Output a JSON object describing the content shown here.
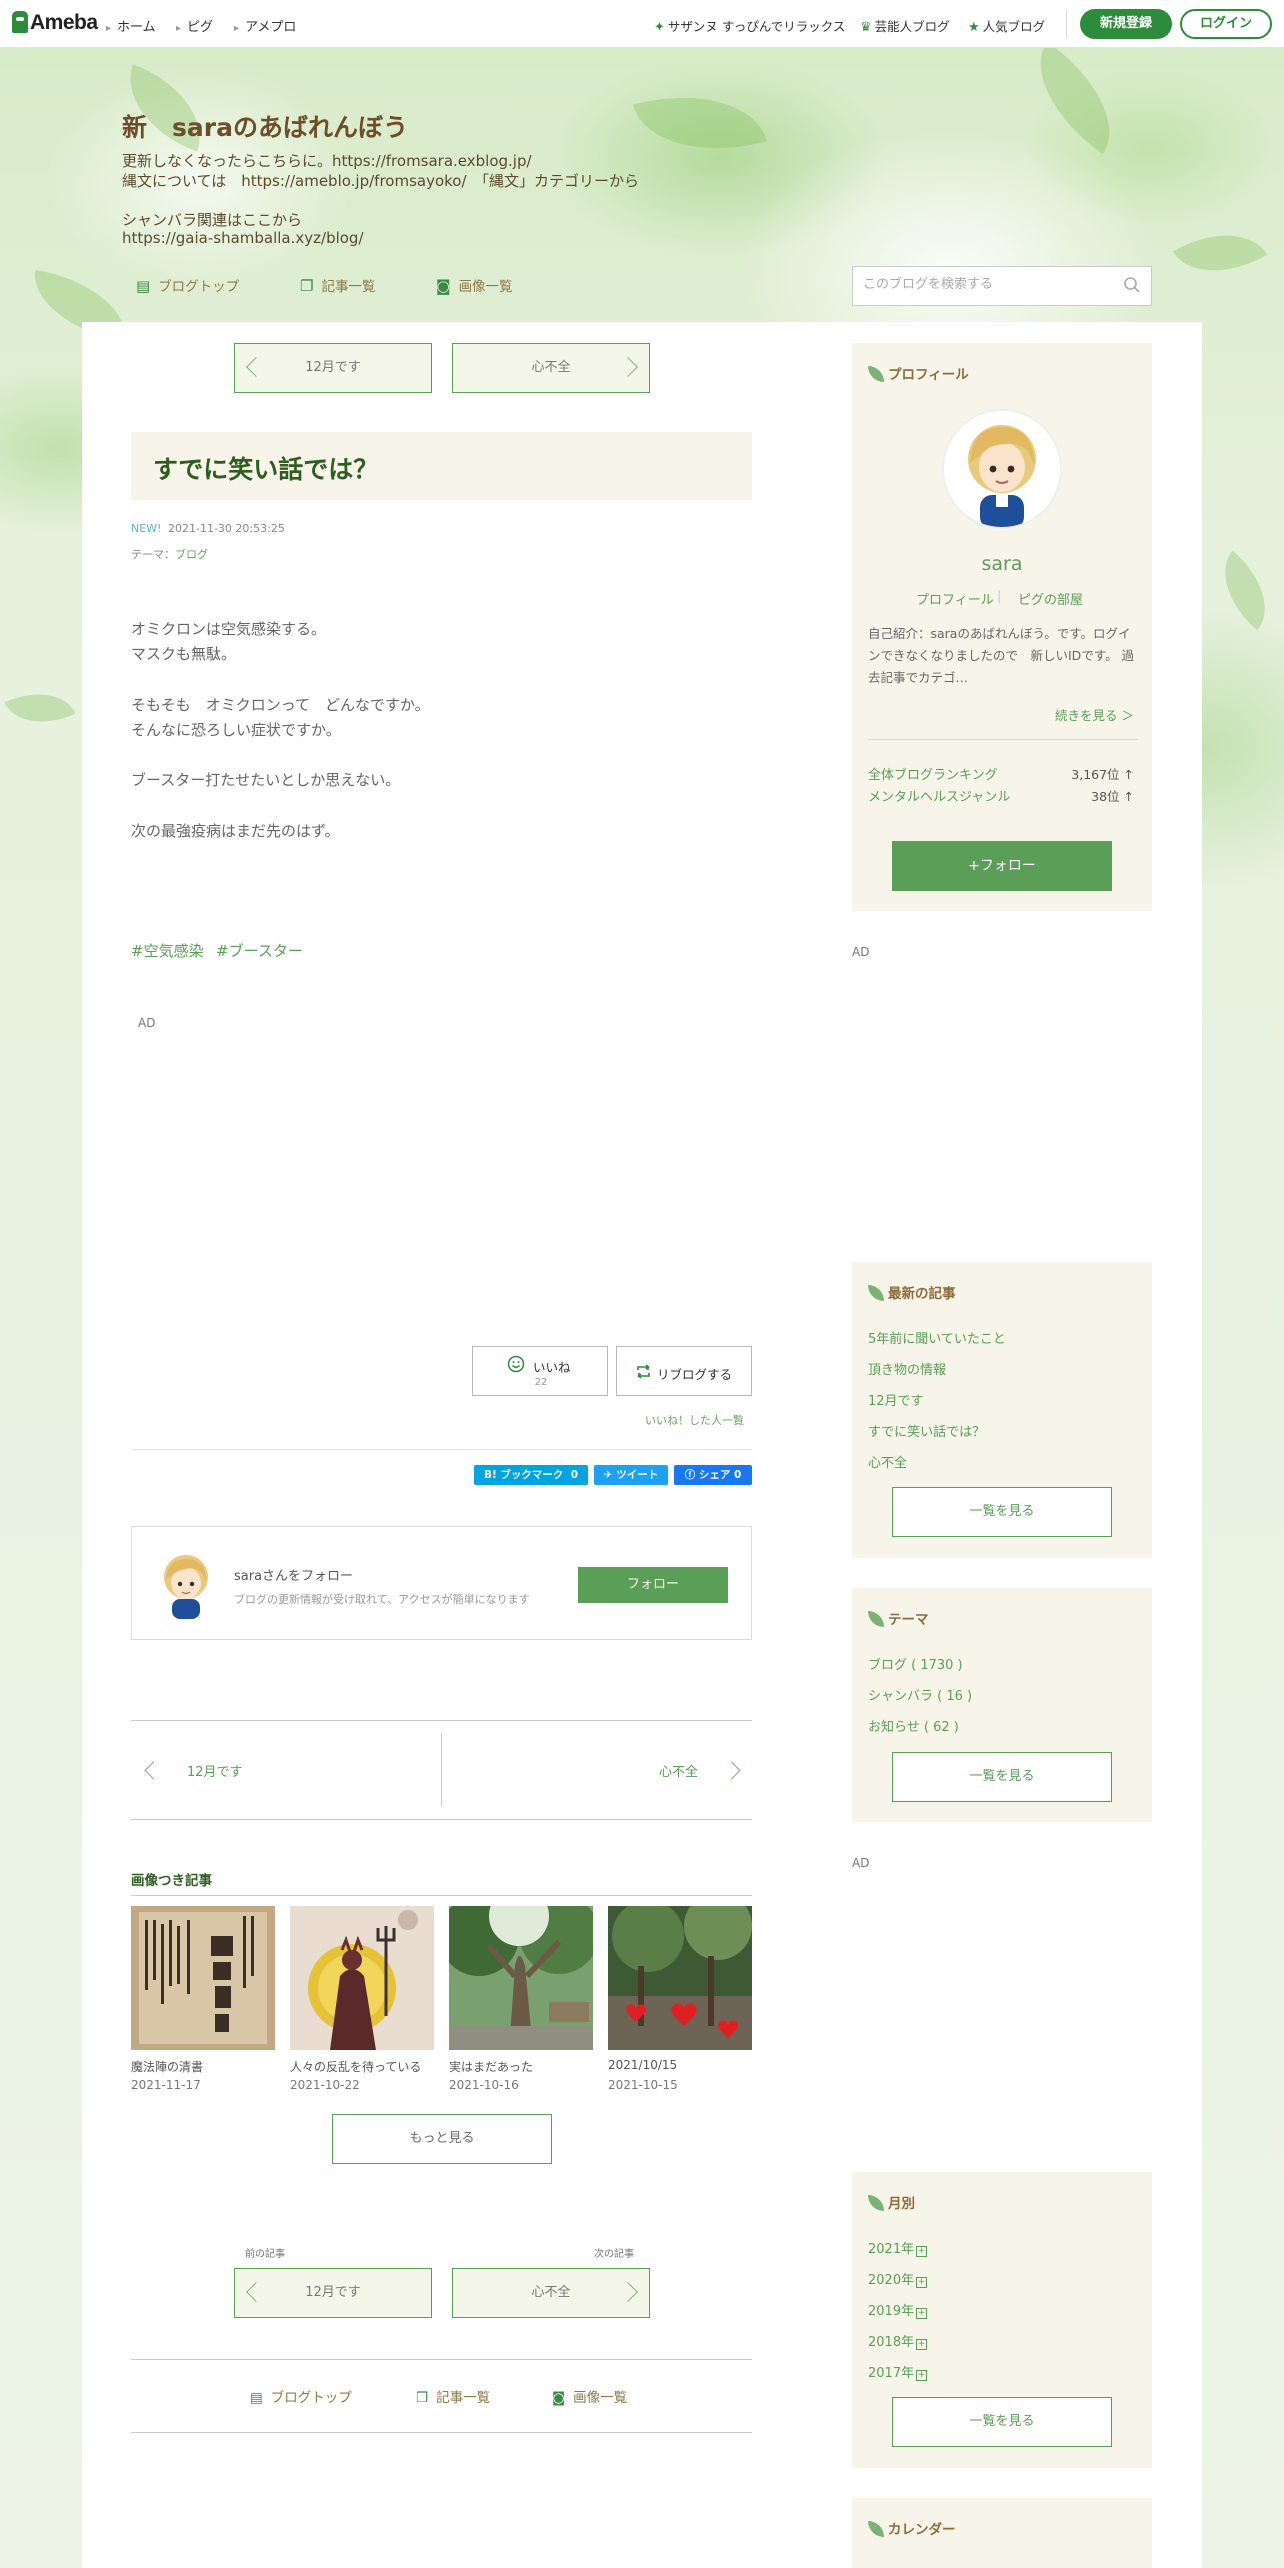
{
  "topnav": {
    "logo": "Ameba",
    "crumbs": [
      "ホーム",
      "ピグ",
      "アメプロ"
    ],
    "links": [
      "サザンヌ すっぴんでリラックス",
      "芸能人ブログ",
      "人気ブログ"
    ],
    "register": "新規登録",
    "login": "ログイン"
  },
  "header": {
    "title": "新　saraのあばれんぼう",
    "desc": [
      "更新しなくなったらこちらに。https://fromsara.exblog.jp/",
      "縄文については　https://ameblo.jp/fromsayoko/　「縄文」カテゴリーから",
      "シャンバラ関連はここから",
      "https://gaia-shamballa.xyz/blog/"
    ],
    "nav": [
      "ブログトップ",
      "記事一覧",
      "画像一覧"
    ],
    "search_placeholder": "このブログを検索する"
  },
  "pager_top": {
    "prev": "12月です",
    "next": "心不全"
  },
  "article": {
    "title": "すでに笑い話では？",
    "badge": "NEW!",
    "date": "2021-11-30 20:53:25",
    "theme_prefix": "テーマ：",
    "theme": "ブログ",
    "lines": [
      "オミクロンは空気感染する。",
      "マスクも無駄。",
      "そもそも　オミクロンって　どんなですか。",
      "そんなに恐ろしい症状ですか。",
      "ブースター打たせたいとしか思えない。",
      "次の最強疫病はまだ先のはず。"
    ],
    "hashtags": [
      "#空気感染",
      "#ブースター"
    ],
    "ad": "AD",
    "like_label": "いいね",
    "like_count": "22",
    "reblog_label": "リブログする",
    "like_list": "いいね！した人一覧",
    "share": {
      "hatena": "B! ブックマーク",
      "hatena_count": "0",
      "tweet": "ツイート",
      "fb": "シェア",
      "fb_count": "0"
    }
  },
  "follow_card": {
    "title": "saraさんをフォロー",
    "desc": "ブログの更新情報が受け取れて、アクセスが簡単になります",
    "button": "フォロー"
  },
  "pager_bottom": {
    "prev": "12月です",
    "next": "心不全"
  },
  "image_articles": {
    "title": "画像つき記事",
    "items": [
      {
        "title": "魔法陣の清書",
        "date": "2021-11-17"
      },
      {
        "title": "人々の反乱を待っている",
        "date": "2021-10-22"
      },
      {
        "title": "実はまだあった",
        "date": "2021-10-16"
      },
      {
        "title": "2021/10/15",
        "date": "2021-10-15"
      }
    ],
    "more": "もっと見る"
  },
  "pager_footer": {
    "prev_label": "前の記事",
    "next_label": "次の記事",
    "prev": "12月です",
    "next": "心不全"
  },
  "footer_nav": [
    "ブログトップ",
    "記事一覧",
    "画像一覧"
  ],
  "sidebar": {
    "profile": {
      "heading": "プロフィール",
      "name": "sara",
      "links": [
        "プロフィール",
        "ピグの部屋"
      ],
      "intro": "自己紹介：saraのあばれんぼう。です。ログインできなくなりましたので　新しいIDです。 過去記事でカテゴ…",
      "read_more": "続きを見る ＞",
      "ranks": [
        {
          "label": "全体ブログランキング",
          "value": "3,167位 ↑"
        },
        {
          "label": "メンタルヘルスジャンル",
          "value": "38位 ↑"
        }
      ],
      "follow": "+フォロー"
    },
    "ad": "AD",
    "recent": {
      "heading": "最新の記事",
      "items": [
        "5年前に聞いていたこと",
        "頂き物の情報",
        "12月です",
        "すでに笑い話では？",
        "心不全"
      ],
      "more": "一覧を見る"
    },
    "theme": {
      "heading": "テーマ",
      "items": [
        "ブログ ( 1730 )",
        "シャンバラ ( 16 )",
        "お知らせ ( 62 )"
      ],
      "more": "一覧を見る"
    },
    "ad2": "AD",
    "monthly": {
      "heading": "月別",
      "items": [
        "2021年",
        "2020年",
        "2019年",
        "2018年",
        "2017年"
      ],
      "more": "一覧を見る"
    },
    "calendar": {
      "heading": "カレンダー"
    }
  },
  "colors": {
    "accent": "#5a9e57",
    "brand": "#2d8c3c",
    "title": "#2f5d20",
    "brown": "#8d6b3a"
  }
}
